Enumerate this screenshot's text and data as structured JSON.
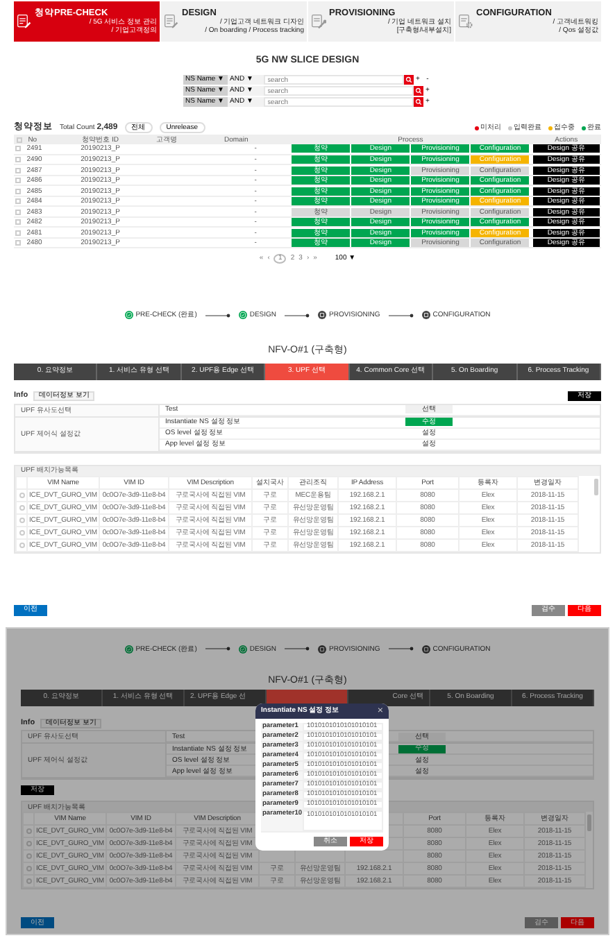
{
  "header_tabs": [
    {
      "title": "청약PRE-CHECK",
      "lines": [
        "/ 5G 서비스 정보 관리",
        "/ 기업고객정의"
      ],
      "selected": true
    },
    {
      "title": "DESIGN",
      "lines": [
        "/ 기업고객 네트워크 디자인",
        "/ On boarding / Process tracking"
      ],
      "selected": false
    },
    {
      "title": "PROVISIONING",
      "lines": [
        "/ 기업 네트워크 설치",
        "[구축형/내부설치]"
      ],
      "selected": false
    },
    {
      "title": "CONFIGURATION",
      "lines": [
        "/ 고객네트워킹",
        "/ Qos 설정값"
      ],
      "selected": false
    }
  ],
  "slice_design": {
    "title": "5G NW SLICE DESIGN",
    "filters": [
      {
        "field": "NS Name ▼",
        "operator": "AND",
        "caret": "▼",
        "placeholder": "search",
        "actions": [
          "+",
          "-"
        ]
      },
      {
        "field": "NS Name ▼",
        "operator": "AND",
        "caret": "▼",
        "placeholder": "search",
        "actions": [
          "+"
        ]
      },
      {
        "field": "NS Name ▼",
        "operator": "AND",
        "caret": "▼",
        "placeholder": "search",
        "actions": [
          "+"
        ]
      }
    ]
  },
  "subscriptions": {
    "title": "청약정보",
    "total_label": "Total Count",
    "total": "2,489",
    "filters": [
      "전체",
      "Unrelease"
    ],
    "legend": [
      {
        "label": "미처리",
        "color": "#e60012"
      },
      {
        "label": "입력완료",
        "color": "#c8c8c8"
      },
      {
        "label": "접수중",
        "color": "#f5b400"
      },
      {
        "label": "완료",
        "color": "#00a651"
      }
    ],
    "all_checked": false,
    "columns": [
      "No",
      "청약번호 ID",
      "고객명",
      "Domain",
      "Process",
      "Actions"
    ],
    "rows": [
      {
        "checked": false,
        "no": "2491",
        "id": "20190213_P",
        "domain": "-",
        "process": [
          {
            "label": "청약",
            "color": "#00a651"
          },
          {
            "label": "Design",
            "color": "#00a651"
          },
          {
            "label": "Provisioning",
            "color": "#00a651"
          },
          {
            "label": "Configuration",
            "color": "#00a651"
          }
        ],
        "action": "Design 공유"
      },
      {
        "checked": false,
        "no": "2490",
        "id": "20190213_P",
        "domain": "-",
        "process": [
          {
            "label": "청약",
            "color": "#00a651"
          },
          {
            "label": "Design",
            "color": "#00a651"
          },
          {
            "label": "Provisioning",
            "color": "#00a651"
          },
          {
            "label": "Configuration",
            "color": "#f5b400"
          }
        ],
        "action": "Design 공유"
      },
      {
        "checked": false,
        "no": "2487",
        "id": "20190213_P",
        "domain": "-",
        "process": [
          {
            "label": "청약",
            "color": "#00a651"
          },
          {
            "label": "Design",
            "color": "#00a651"
          },
          {
            "label": "Provisioning",
            "color": "#d8d8d8"
          },
          {
            "label": "Configuration",
            "color": "#d8d8d8"
          }
        ],
        "action": "Design 공유"
      },
      {
        "checked": false,
        "no": "2486",
        "id": "20190213_P",
        "domain": "-",
        "process": [
          {
            "label": "청약",
            "color": "#00a651"
          },
          {
            "label": "Design",
            "color": "#00a651"
          },
          {
            "label": "Provisioning",
            "color": "#00a651"
          },
          {
            "label": "Configuration",
            "color": "#00a651"
          }
        ],
        "action": "Design 공유"
      },
      {
        "checked": false,
        "no": "2485",
        "id": "20190213_P",
        "domain": "-",
        "process": [
          {
            "label": "청약",
            "color": "#00a651"
          },
          {
            "label": "Design",
            "color": "#00a651"
          },
          {
            "label": "Provisioning",
            "color": "#00a651"
          },
          {
            "label": "Configuration",
            "color": "#00a651"
          }
        ],
        "action": "Design 공유"
      },
      {
        "checked": false,
        "no": "2484",
        "id": "20190213_P",
        "domain": "-",
        "process": [
          {
            "label": "청약",
            "color": "#00a651"
          },
          {
            "label": "Design",
            "color": "#00a651"
          },
          {
            "label": "Provisioning",
            "color": "#00a651"
          },
          {
            "label": "Configuration",
            "color": "#f5b400"
          }
        ],
        "action": "Design 공유"
      },
      {
        "checked": false,
        "no": "2483",
        "id": "20190213_P",
        "domain": "-",
        "process": [
          {
            "label": "청약",
            "color": "#d8d8d8"
          },
          {
            "label": "Design",
            "color": "#d8d8d8"
          },
          {
            "label": "Provisioning",
            "color": "#d8d8d8"
          },
          {
            "label": "Configuration",
            "color": "#d8d8d8"
          }
        ],
        "action": "Design 공유"
      },
      {
        "checked": false,
        "no": "2482",
        "id": "20190213_P",
        "domain": "-",
        "process": [
          {
            "label": "청약",
            "color": "#00a651"
          },
          {
            "label": "Design",
            "color": "#00a651"
          },
          {
            "label": "Provisioning",
            "color": "#00a651"
          },
          {
            "label": "Configuration",
            "color": "#00a651"
          }
        ],
        "action": "Design 공유"
      },
      {
        "checked": false,
        "no": "2481",
        "id": "20190213_P",
        "domain": "-",
        "process": [
          {
            "label": "청약",
            "color": "#00a651"
          },
          {
            "label": "Design",
            "color": "#00a651"
          },
          {
            "label": "Provisioning",
            "color": "#00a651"
          },
          {
            "label": "Configuration",
            "color": "#f5b400"
          }
        ],
        "action": "Design 공유"
      },
      {
        "checked": false,
        "no": "2480",
        "id": "20190213_P",
        "domain": "-",
        "process": [
          {
            "label": "청약",
            "color": "#00a651"
          },
          {
            "label": "Design",
            "color": "#00a651"
          },
          {
            "label": "Provisioning",
            "color": "#d8d8d8"
          },
          {
            "label": "Configuration",
            "color": "#d8d8d8"
          }
        ],
        "action": "Design 공유"
      }
    ],
    "pagination": {
      "first": "«",
      "prev": "‹",
      "pages": [
        {
          "label": "1",
          "selected": true
        },
        {
          "label": "2",
          "selected": false
        },
        {
          "label": "3",
          "selected": false
        }
      ],
      "next": "›",
      "last": "»",
      "page_size": "100",
      "caret": "▼"
    }
  },
  "views": [
    {
      "stepper": [
        {
          "label": "PRE-CHECK (완료)",
          "done": true
        },
        {
          "label": "DESIGN",
          "done": true
        },
        {
          "label": "PROVISIONING",
          "done": false
        },
        {
          "label": "CONFIGURATION",
          "done": false
        }
      ],
      "title": "NFV-O#1 (구축형)",
      "tabs": [
        {
          "label": "0. 요약정보",
          "selected": false
        },
        {
          "label": "1. 서비스 유형 선택",
          "selected": false
        },
        {
          "label": "2. UPF용 Edge 선택",
          "selected": false
        },
        {
          "label": "3. UPF 선택",
          "selected": true
        },
        {
          "label": "4. Common Core 선택",
          "selected": false
        },
        {
          "label": "5. On Boarding",
          "selected": false
        },
        {
          "label": "6. Process Tracking",
          "selected": false
        }
      ],
      "info": {
        "title": "Info",
        "button": "데이터정보 보기",
        "save": {
          "label": "저장",
          "at_top": true
        },
        "groups": [
          {
            "label": "UPF 유사도선택",
            "rows": [
              {
                "label": "Test",
                "value": "선택",
                "kind": "select"
              }
            ]
          },
          {
            "label": "UPF 제어식 설정값",
            "rows": [
              {
                "label": "Instantiate NS 설정 정보",
                "value": "수정",
                "kind": "button"
              },
              {
                "label": "OS level 설정 정보",
                "value": "설정",
                "kind": "text"
              },
              {
                "label": "App level 설정 정보",
                "value": "설정",
                "kind": "text"
              }
            ]
          }
        ]
      },
      "upf": {
        "title": "UPF 배치가능목록",
        "columns": [
          "VIM Name",
          "VIM ID",
          "VIM Description",
          "설치국사",
          "관리조직",
          "IP Address",
          "Port",
          "등록자",
          "변경일자"
        ],
        "rows": [
          {
            "selected": false,
            "cells": [
              "ICE_DVT_GURO_VIM",
              "0c0O7e-3d9-11e8-b4",
              "구로국사에 직접된 VIM",
              "구로",
              "MEC운용팀",
              "192.168.2.1",
              "8080",
              "Elex",
              "2018-11-15"
            ]
          },
          {
            "selected": false,
            "cells": [
              "ICE_DVT_GURO_VIM",
              "0c0O7e-3d9-11e8-b4",
              "구로국사에 직접된 VIM",
              "구로",
              "유선망운영팀",
              "192.168.2.1",
              "8080",
              "Elex",
              "2018-11-15"
            ]
          },
          {
            "selected": false,
            "cells": [
              "ICE_DVT_GURO_VIM",
              "0c0O7e-3d9-11e8-b4",
              "구로국사에 직접된 VIM",
              "구로",
              "유선망운영팀",
              "192.168.2.1",
              "8080",
              "Elex",
              "2018-11-15"
            ]
          },
          {
            "selected": false,
            "cells": [
              "ICE_DVT_GURO_VIM",
              "0c0O7e-3d9-11e8-b4",
              "구로국사에 직접된 VIM",
              "구로",
              "유선망운영팀",
              "192.168.2.1",
              "8080",
              "Elex",
              "2018-11-15"
            ]
          },
          {
            "selected": false,
            "cells": [
              "ICE_DVT_GURO_VIM",
              "0c0O7e-3d9-11e8-b4",
              "구로국사에 직접된 VIM",
              "구로",
              "유선망운영팀",
              "192.168.2.1",
              "8080",
              "Elex",
              "2018-11-15"
            ]
          }
        ]
      },
      "footer": {
        "prev": "이전",
        "check": "검수",
        "next": "다음"
      }
    },
    {
      "stepper": [
        {
          "label": "PRE-CHECK (완료)",
          "done": true
        },
        {
          "label": "DESIGN",
          "done": true
        },
        {
          "label": "PROVISIONING",
          "done": false
        },
        {
          "label": "CONFIGURATION",
          "done": false
        }
      ],
      "title": "NFV-O#1 (구축형)",
      "tabs": [
        {
          "label": "0. 요약정보",
          "selected": false
        },
        {
          "label": "1. 서비스 유형 선택",
          "selected": false
        },
        {
          "label": "2. UPF용 Edge 선",
          "selected": false
        },
        {
          "selected": true
        },
        {
          "label": "Core 선택",
          "selected": false
        },
        {
          "label": "5. On Boarding",
          "selected": false
        },
        {
          "label": "6. Process Tracking",
          "selected": false
        }
      ],
      "info": {
        "title": "Info",
        "button": "데이터정보 보기",
        "save": {
          "label": "저장",
          "at_top": false
        },
        "groups": [
          {
            "label": "UPF 유사도선택",
            "rows": [
              {
                "label": "Test",
                "value": "선택",
                "kind": "select"
              }
            ]
          },
          {
            "label": "UPF 제어식 설정값",
            "rows": [
              {
                "label": "Instantiate NS 설정 정보",
                "value": "수정",
                "kind": "button"
              },
              {
                "label": "OS level 설정 정보",
                "value": "설정",
                "kind": "text"
              },
              {
                "label": "App level 설정 정보",
                "value": "설정",
                "kind": "text"
              }
            ]
          }
        ]
      },
      "upf": {
        "title": "UPF 배치가능목록",
        "columns": [
          "VIM Name",
          "VIM ID",
          "VIM Description",
          null,
          null,
          null,
          "Port",
          "등록자",
          "변경일자"
        ],
        "rows": [
          {
            "selected": false,
            "cells": [
              "ICE_DVT_GURO_VIM",
              "0c0O7e-3d9-11e8-b4",
              "구로국사에 직접된 VIM",
              null,
              null,
              null,
              "8080",
              "Elex",
              "2018-11-15"
            ]
          },
          {
            "selected": false,
            "cells": [
              "ICE_DVT_GURO_VIM",
              "0c0O7e-3d9-11e8-b4",
              "구로국사에 직접된 VIM",
              null,
              null,
              null,
              "8080",
              "Elex",
              "2018-11-15"
            ]
          },
          {
            "selected": false,
            "cells": [
              "ICE_DVT_GURO_VIM",
              "0c0O7e-3d9-11e8-b4",
              "구로국사에 직접된 VIM",
              null,
              null,
              null,
              "8080",
              "Elex",
              "2018-11-15"
            ]
          },
          {
            "selected": false,
            "cells": [
              "ICE_DVT_GURO_VIM",
              "0c0O7e-3d9-11e8-b4",
              "구로국사에 직접된 VIM",
              "구로",
              "유선망운영팀",
              "192.168.2.1",
              "8080",
              "Elex",
              "2018-11-15"
            ]
          },
          {
            "selected": false,
            "cells": [
              "ICE_DVT_GURO_VIM",
              "0c0O7e-3d9-11e8-b4",
              "구로국사에 직접된 VIM",
              "구로",
              "유선망운영팀",
              "192.168.2.1",
              "8080",
              "Elex",
              "2018-11-15"
            ]
          }
        ]
      },
      "footer": {
        "prev": "이전",
        "check": "검수",
        "next": "다음"
      },
      "modal": {
        "title": "Instantiate NS 설정 정보",
        "close": "×",
        "params": [
          {
            "label": "parameter1",
            "value": "1010101010101010101"
          },
          {
            "label": "parameter2",
            "value": "1010101010101010101"
          },
          {
            "label": "parameter3",
            "value": "1010101010101010101"
          },
          {
            "label": "parameter4",
            "value": "1010101010101010101"
          },
          {
            "label": "parameter5",
            "value": "1010101010101010101"
          },
          {
            "label": "parameter6",
            "value": "1010101010101010101"
          },
          {
            "label": "parameter7",
            "value": "1010101010101010101"
          },
          {
            "label": "parameter8",
            "value": "1010101010101010101"
          },
          {
            "label": "parameter9",
            "value": "1010101010101010101"
          },
          {
            "label": "parameter10",
            "value": "1010101010101010101",
            "kind": "textarea"
          }
        ],
        "cancel": "취소",
        "save": "저장"
      }
    }
  ]
}
